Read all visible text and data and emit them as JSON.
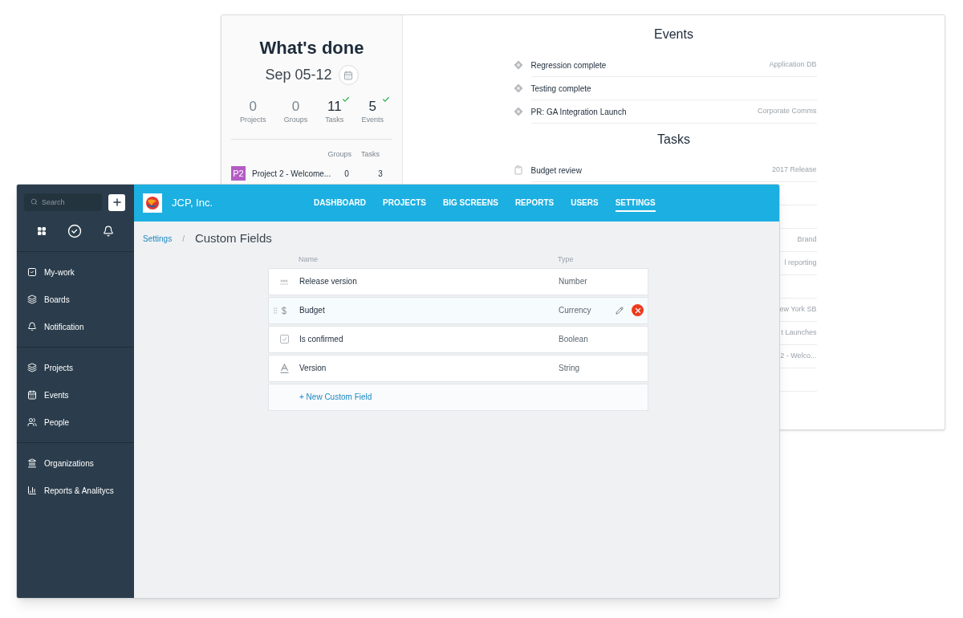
{
  "back_window": {
    "summary": {
      "title": "What's done",
      "date_range": "Sep 05-12",
      "stats": [
        {
          "value": "0",
          "label": "Projects",
          "done": false
        },
        {
          "value": "0",
          "label": "Groups",
          "done": false
        },
        {
          "value": "11",
          "label": "Tasks",
          "done": true
        },
        {
          "value": "5",
          "label": "Events",
          "done": true
        }
      ],
      "columns": [
        "Groups",
        "Tasks"
      ],
      "rows": [
        {
          "badge": "P2",
          "color": "#b45cc4",
          "name": "Project 2 - Welcome...",
          "groups": "0",
          "tasks": "3"
        }
      ]
    },
    "events": {
      "title": "Events",
      "items": [
        {
          "name": "Regression complete",
          "source": "Application DB"
        },
        {
          "name": "Testing complete"
        },
        {
          "name": "PR: GA Integration Launch",
          "source": "Corporate Comms"
        }
      ]
    },
    "tasks": {
      "title": "Tasks",
      "items": [
        {
          "name": "Budget review",
          "source": "2017 Release"
        },
        {
          "source": "Brand"
        },
        {
          "source": "l reporting"
        },
        {
          "source": "ew York SB"
        },
        {
          "source": "t Launches"
        },
        {
          "source": "2 - Welco..."
        }
      ]
    }
  },
  "front_window": {
    "sidebar": {
      "search": {
        "placeholder": "Search"
      },
      "sections": [
        [
          {
            "label": "My-work"
          },
          {
            "label": "Boards"
          },
          {
            "label": "Notification"
          }
        ],
        [
          {
            "label": "Projects"
          },
          {
            "label": "Events"
          },
          {
            "label": "People"
          }
        ],
        [
          {
            "label": "Organizations"
          },
          {
            "label": "Reports & Analitycs"
          }
        ]
      ]
    },
    "header": {
      "company": "JCP, Inc.",
      "nav": [
        {
          "label": "DASHBOARD",
          "selected": false
        },
        {
          "label": "PROJECTS",
          "selected": false
        },
        {
          "label": "BIG SCREENS",
          "selected": false
        },
        {
          "label": "REPORTS",
          "selected": false
        },
        {
          "label": "USERS",
          "selected": false
        },
        {
          "label": "SETTINGS",
          "selected": true
        }
      ]
    },
    "breadcrumb": {
      "parent": "Settings",
      "separator": "/",
      "current": "Custom Fields"
    },
    "table": {
      "columns": [
        "Name",
        "Type"
      ],
      "rows": [
        {
          "kind": "number",
          "name": "Release version",
          "type": "Number",
          "selected": false
        },
        {
          "kind": "currency",
          "name": "Budget",
          "type": "Currency",
          "selected": true
        },
        {
          "kind": "boolean",
          "name": "Is confirmed",
          "type": "Boolean",
          "selected": false
        },
        {
          "kind": "string",
          "name": "Version",
          "type": "String",
          "selected": false
        }
      ],
      "add_link": "+ New Custom Field"
    }
  }
}
